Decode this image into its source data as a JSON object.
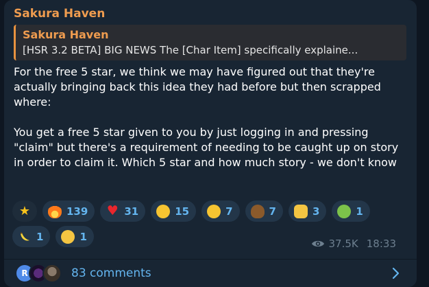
{
  "channel": {
    "sender": "Sakura Haven"
  },
  "reply": {
    "name": "Sakura Haven",
    "text": "[HSR 3.2 BETA] BIG NEWS  The [Char Item] specifically explaine..."
  },
  "message": {
    "paragraphs": [
      "For the free 5 star, we think we may have figured out that they're actually bringing back this idea they had before but then scrapped where:",
      "You get a free 5 star given to you by just logging in and pressing \"claim\" but there's a requirement of needing to be caught up on story in order to claim it. Which 5 star and how much story - we don't know"
    ]
  },
  "reactions": [
    {
      "icon": "star-icon",
      "glyph": "★",
      "count": ""
    },
    {
      "icon": "fire-icon",
      "glyph": "",
      "count": "139"
    },
    {
      "icon": "heart-icon",
      "glyph": "♥",
      "count": "31"
    },
    {
      "icon": "exploding-head-icon",
      "glyph": "",
      "count": "15"
    },
    {
      "icon": "thinking-face-icon",
      "glyph": "",
      "count": "7"
    },
    {
      "icon": "poop-icon",
      "glyph": "",
      "count": "7"
    },
    {
      "icon": "thumbs-up-icon",
      "glyph": "",
      "count": "3"
    },
    {
      "icon": "nauseated-face-icon",
      "glyph": "",
      "count": "1"
    },
    {
      "icon": "banana-icon",
      "glyph": "",
      "count": "1"
    },
    {
      "icon": "crying-face-icon",
      "glyph": "",
      "count": "1"
    }
  ],
  "meta": {
    "views": "37.5K",
    "time": "18:33"
  },
  "comments": {
    "avatar_initial": "R",
    "label": "83 comments"
  },
  "colors": {
    "accent": "#64b5ef",
    "sender": "#ef9c4f",
    "bubble": "#182533"
  }
}
